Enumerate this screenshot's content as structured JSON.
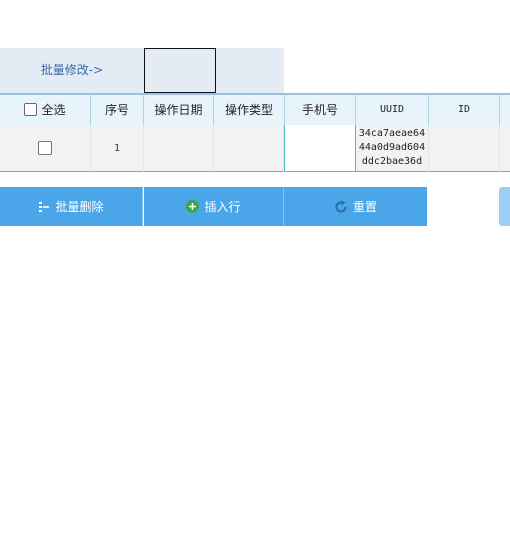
{
  "batch": {
    "label": "批量修改->",
    "value": ""
  },
  "table": {
    "header": {
      "select_all": "全选",
      "seq": "序号",
      "op_date": "操作日期",
      "op_type": "操作类型",
      "phone": "手机号",
      "uuid": "UUID",
      "id": "ID"
    },
    "rows": [
      {
        "seq": "1",
        "op_date": "",
        "op_type": "",
        "phone": "",
        "uuid": "34ca7aeae6444a0d9ad604ddc2bae36d",
        "id": ""
      }
    ]
  },
  "actions": {
    "batch_delete": "批量删除",
    "insert_row": "插入行",
    "reset": "重置"
  },
  "icons": {
    "batch_delete": "delete-list-icon",
    "insert_row": "plus-circle-icon",
    "reset": "refresh-icon"
  },
  "colors": {
    "primary_button": "#4aa6e9",
    "batch_bar_bg": "#e3ebf4",
    "batch_label": "#3c6aa5",
    "row_border": "#49c2c9",
    "insert_icon": "#3aa64b",
    "reset_icon": "#2a6fb0"
  }
}
